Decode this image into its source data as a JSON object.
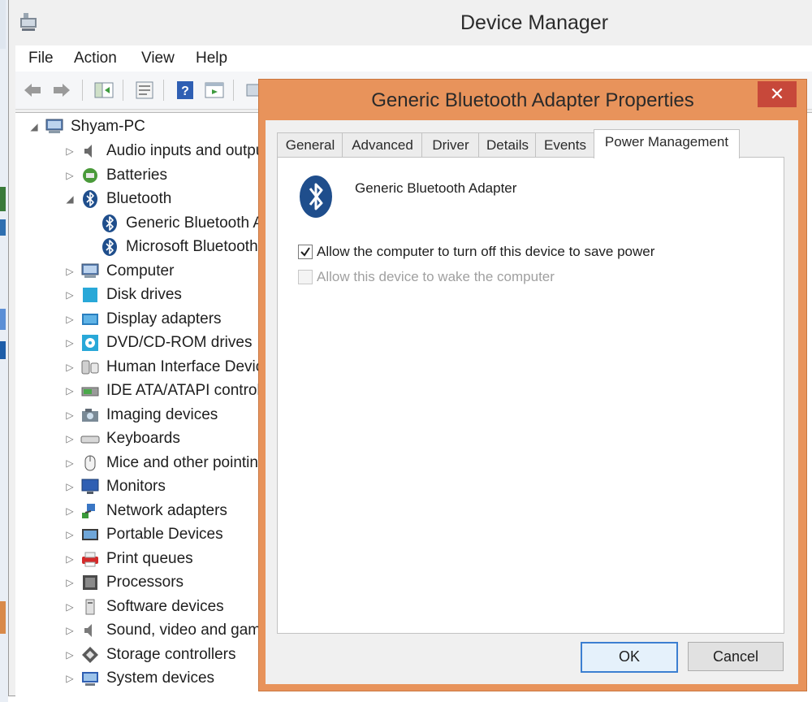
{
  "window": {
    "title": "Device Manager"
  },
  "menu": [
    "File",
    "Action",
    "View",
    "Help"
  ],
  "toolbar": [
    "back-icon",
    "forward-icon",
    "show-hide-tree-icon",
    "properties-icon",
    "help-icon",
    "view-icon",
    "scan-icon"
  ],
  "tree": {
    "root": "Shyam-PC",
    "items": [
      {
        "label": "Audio inputs and outputs",
        "icon": "speaker-icon",
        "state": "collapsed",
        "level": 1
      },
      {
        "label": "Batteries",
        "icon": "battery-icon",
        "state": "collapsed",
        "level": 1
      },
      {
        "label": "Bluetooth",
        "icon": "bluetooth-icon",
        "state": "expanded",
        "level": 1
      },
      {
        "label": "Generic Bluetooth Adapter",
        "icon": "bluetooth-icon",
        "state": "leaf",
        "level": 2
      },
      {
        "label": "Microsoft Bluetooth Enumerator",
        "icon": "bluetooth-icon",
        "state": "leaf",
        "level": 2
      },
      {
        "label": "Computer",
        "icon": "computer-icon",
        "state": "collapsed",
        "level": 1
      },
      {
        "label": "Disk drives",
        "icon": "disk-icon",
        "state": "collapsed",
        "level": 1
      },
      {
        "label": "Display adapters",
        "icon": "display-adapter-icon",
        "state": "collapsed",
        "level": 1
      },
      {
        "label": "DVD/CD-ROM drives",
        "icon": "dvd-icon",
        "state": "collapsed",
        "level": 1
      },
      {
        "label": "Human Interface Devices",
        "icon": "hid-icon",
        "state": "collapsed",
        "level": 1
      },
      {
        "label": "IDE ATA/ATAPI controllers",
        "icon": "ide-icon",
        "state": "collapsed",
        "level": 1
      },
      {
        "label": "Imaging devices",
        "icon": "camera-icon",
        "state": "collapsed",
        "level": 1
      },
      {
        "label": "Keyboards",
        "icon": "keyboard-icon",
        "state": "collapsed",
        "level": 1
      },
      {
        "label": "Mice and other pointing devices",
        "icon": "mouse-icon",
        "state": "collapsed",
        "level": 1
      },
      {
        "label": "Monitors",
        "icon": "monitor-icon",
        "state": "collapsed",
        "level": 1
      },
      {
        "label": "Network adapters",
        "icon": "network-icon",
        "state": "collapsed",
        "level": 1
      },
      {
        "label": "Portable Devices",
        "icon": "portable-device-icon",
        "state": "collapsed",
        "level": 1
      },
      {
        "label": "Print queues",
        "icon": "printer-icon",
        "state": "collapsed",
        "level": 1
      },
      {
        "label": "Processors",
        "icon": "processor-icon",
        "state": "collapsed",
        "level": 1
      },
      {
        "label": "Software devices",
        "icon": "software-device-icon",
        "state": "collapsed",
        "level": 1
      },
      {
        "label": "Sound, video and game controllers",
        "icon": "sound-icon",
        "state": "collapsed",
        "level": 1
      },
      {
        "label": "Storage controllers",
        "icon": "storage-icon",
        "state": "collapsed",
        "level": 1
      },
      {
        "label": "System devices",
        "icon": "system-device-icon",
        "state": "collapsed",
        "level": 1
      }
    ]
  },
  "dialog": {
    "title": "Generic Bluetooth Adapter Properties",
    "close": "✕",
    "tabs": [
      "General",
      "Advanced",
      "Driver",
      "Details",
      "Events",
      "Power Management"
    ],
    "active_tab": "Power Management",
    "device_name": "Generic Bluetooth Adapter",
    "options": [
      {
        "label": "Allow the computer to turn off this device to save power",
        "checked": true,
        "enabled": true
      },
      {
        "label": "Allow this device to wake the computer",
        "checked": false,
        "enabled": false
      }
    ],
    "ok": "OK",
    "cancel": "Cancel"
  },
  "colors": {
    "dialog_frame": "#e8935b",
    "close_button": "#c7483a",
    "bluetooth": "#1f4e8c"
  }
}
